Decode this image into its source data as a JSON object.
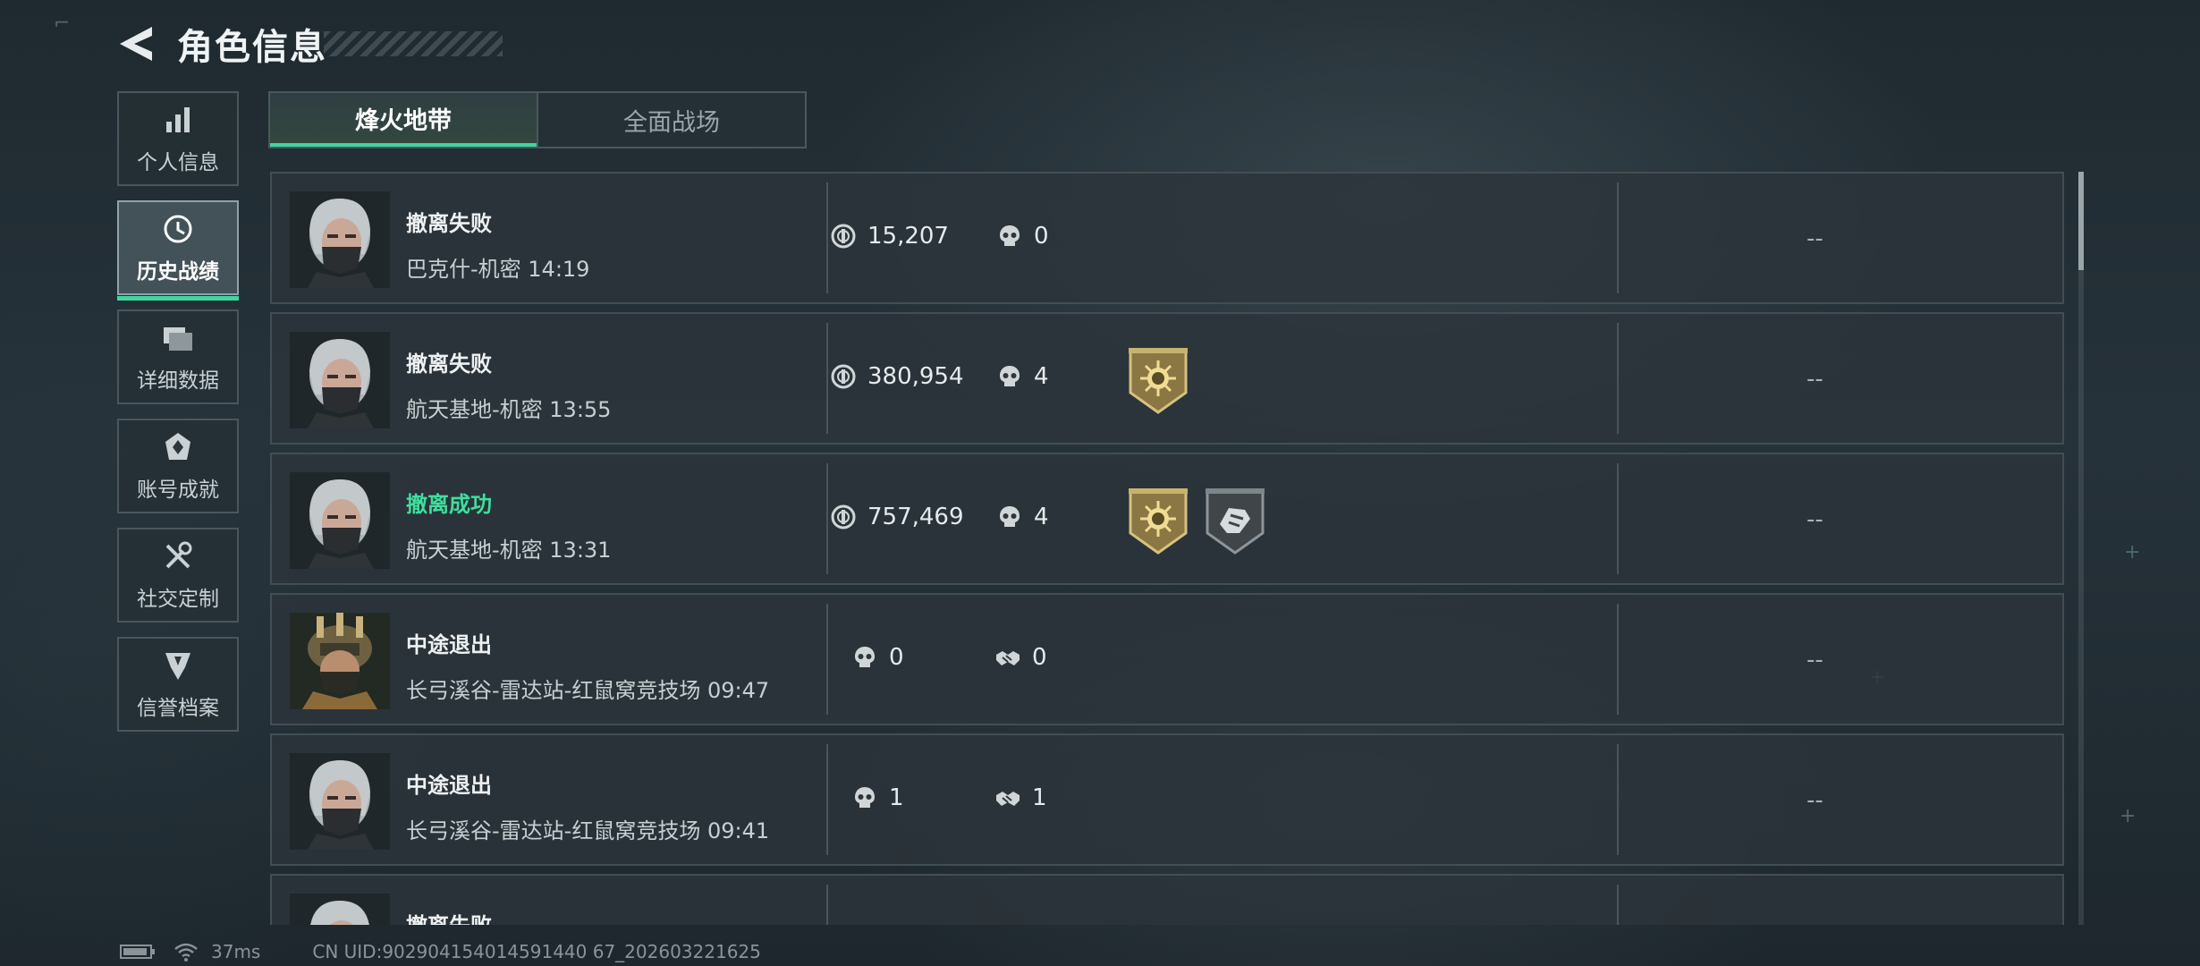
{
  "header": {
    "title": "角色信息"
  },
  "sidebar": {
    "items": [
      {
        "label": "个人信息",
        "icon": "bar-chart-icon",
        "active": false
      },
      {
        "label": "历史战绩",
        "icon": "history-clock-icon",
        "active": true
      },
      {
        "label": "详细数据",
        "icon": "folders-icon",
        "active": false
      },
      {
        "label": "账号成就",
        "icon": "achievement-icon",
        "active": false
      },
      {
        "label": "社交定制",
        "icon": "tools-icon",
        "active": false
      },
      {
        "label": "信誉档案",
        "icon": "credit-emblem-icon",
        "active": false
      }
    ]
  },
  "tabs": [
    {
      "label": "烽火地带",
      "active": true
    },
    {
      "label": "全面战场",
      "active": false
    }
  ],
  "matches": [
    {
      "status": "撤离失败",
      "success": false,
      "map": "巴克什-机密 14:19",
      "coins": "15,207",
      "kills": "0",
      "badges": [],
      "result": "--"
    },
    {
      "status": "撤离失败",
      "success": false,
      "map": "航天基地-机密 13:55",
      "coins": "380,954",
      "kills": "4",
      "badges": [
        "gold-sun-badge"
      ],
      "result": "--"
    },
    {
      "status": "撤离成功",
      "success": true,
      "map": "航天基地-机密 13:31",
      "coins": "757,469",
      "kills": "4",
      "badges": [
        "gold-sun-badge",
        "grey-hand-badge"
      ],
      "result": "--"
    },
    {
      "status": "中途退出",
      "success": false,
      "map": "长弓溪谷-雷达站-红鼠窝竞技场 09:47",
      "kills": "0",
      "assists": "0",
      "badges": [],
      "result": "--"
    },
    {
      "status": "中途退出",
      "success": false,
      "map": "长弓溪谷-雷达站-红鼠窝竞技场 09:41",
      "kills": "1",
      "assists": "1",
      "badges": [],
      "result": "--"
    },
    {
      "status": "撤离失败",
      "success": false,
      "map": "",
      "badges": [],
      "result": ""
    }
  ],
  "footer": {
    "ping": "37ms",
    "uid": "CN UID:902904154014591440 67_202603221625"
  },
  "colors": {
    "accent": "#3fd6a0",
    "success": "#3fdf9e",
    "badge_gold": "#b8a062"
  }
}
